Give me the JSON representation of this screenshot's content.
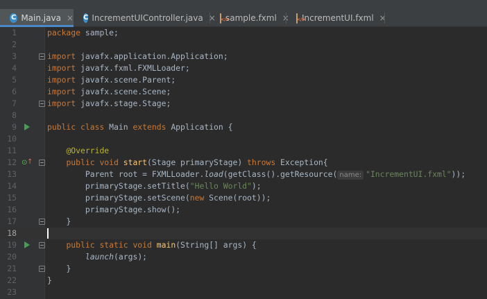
{
  "tabs": [
    {
      "label": "Main.java",
      "icon": "java-class-icon",
      "active": true
    },
    {
      "label": "IncrementUIController.java",
      "icon": "java-class-icon",
      "active": false
    },
    {
      "label": "sample.fxml",
      "icon": "fxml-file-icon",
      "active": false
    },
    {
      "label": "IncrementUI.fxml",
      "icon": "fxml-file-icon",
      "active": false
    }
  ],
  "tab_close_glyph": "×",
  "class_icon_letter": "C",
  "colors": {
    "background": "#2b2b2b",
    "gutter": "#313335",
    "keyword": "#cc7832",
    "string": "#6a8759",
    "annotation": "#bbb529",
    "method_decl": "#ffc66d",
    "default_text": "#a9b7c6",
    "active_tab_underline": "#4a88c7",
    "run_icon": "#499c54"
  },
  "editor": {
    "current_line": 18,
    "line_numbers": [
      "1",
      "2",
      "3",
      "4",
      "5",
      "6",
      "7",
      "8",
      "9",
      "10",
      "11",
      "12",
      "13",
      "14",
      "15",
      "16",
      "17",
      "18",
      "19",
      "20",
      "21",
      "22",
      "23"
    ],
    "lines": {
      "l1": {
        "kw": "package",
        "rest": " sample;"
      },
      "l3": {
        "kw": "import",
        "rest": " javafx.application.Application;"
      },
      "l4": {
        "kw": "import",
        "rest": " javafx.fxml.FXMLLoader;"
      },
      "l5": {
        "kw": "import",
        "rest": " javafx.scene.Parent;"
      },
      "l6": {
        "kw": "import",
        "rest": " javafx.scene.Scene;"
      },
      "l7": {
        "kw": "import",
        "rest": " javafx.stage.Stage;"
      },
      "l9": {
        "kw1": "public class",
        "name": " Main ",
        "kw2": "extends",
        "rest": " Application {"
      },
      "l11": {
        "annotation": "@Override"
      },
      "l12": {
        "kw": "public void",
        "method": "start",
        "params": "(Stage primaryStage) ",
        "kw2": "throws",
        "rest": " Exception{"
      },
      "l13": {
        "pre": "Parent root = FXMLLoader.",
        "call": "load",
        "mid": "(getClass().getResource(",
        "hint": "name:",
        "str": "\"IncrementUI.fxml\"",
        "post": "));"
      },
      "l14": {
        "pre": "primaryStage.setTitle(",
        "str": "\"Hello World\"",
        "post": ");"
      },
      "l15": {
        "pre": "primaryStage.setScene(",
        "kw": "new",
        "post": " Scene(root));"
      },
      "l16": {
        "text": "primaryStage.show();"
      },
      "l17": {
        "text": "}"
      },
      "l19": {
        "kw": "public static void",
        "method": "main",
        "rest": "(String[] args) {"
      },
      "l20": {
        "call": "launch",
        "rest": "(args);"
      },
      "l21": {
        "text": "}"
      },
      "l22": {
        "text": "}"
      }
    }
  }
}
